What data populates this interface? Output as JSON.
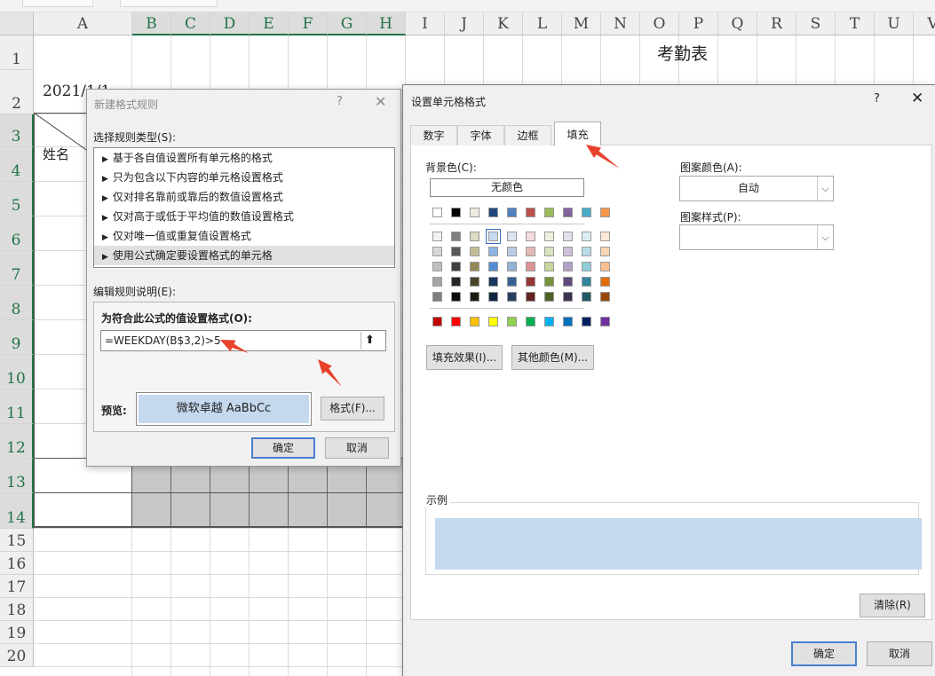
{
  "spreadsheet": {
    "columns": [
      "A",
      "B",
      "C",
      "D",
      "E",
      "F",
      "G",
      "H",
      "I",
      "J",
      "K",
      "L",
      "M",
      "N",
      "O",
      "P",
      "Q",
      "R",
      "S",
      "T",
      "U",
      "V"
    ],
    "rows": [
      "1",
      "2",
      "3",
      "4",
      "5",
      "6",
      "7",
      "8",
      "9",
      "10",
      "11",
      "12",
      "13",
      "14",
      "15",
      "16",
      "17",
      "18",
      "19",
      "20"
    ],
    "title": "考勤表",
    "date": "2021/1/1",
    "name_header": "姓名"
  },
  "rule_dialog": {
    "title": "新建格式规则",
    "help": "?",
    "close": "✕",
    "select_type_label": "选择规则类型(S):",
    "rule_types": [
      "基于各自值设置所有单元格的格式",
      "只为包含以下内容的单元格设置格式",
      "仅对排名靠前或靠后的数值设置格式",
      "仅对高于或低于平均值的数值设置格式",
      "仅对唯一值或重复值设置格式",
      "使用公式确定要设置格式的单元格"
    ],
    "selected_rule_index": 5,
    "edit_label": "编辑规则说明(E):",
    "formula_label": "为符合此公式的值设置格式(O):",
    "formula": "=WEEKDAY(B$3,2)>5",
    "collapse_icon": "⬆",
    "preview_label": "预览:",
    "preview_text": "微软卓越  AaBbCc",
    "preview_color": "#c4d8ee",
    "format_button": "格式(F)...",
    "ok_button": "确定",
    "cancel_button": "取消"
  },
  "format_dialog": {
    "title": "设置单元格格式",
    "help": "?",
    "close": "✕",
    "tabs": [
      "数字",
      "字体",
      "边框",
      "填充"
    ],
    "active_tab": "填充",
    "bg_color_label": "背景色(C):",
    "no_color_button": "无颜色",
    "theme_colors_top": [
      "#ffffff",
      "#000000",
      "#eeece1",
      "#1f497d",
      "#4f81bd",
      "#c0504d",
      "#9bbb59",
      "#8064a2",
      "#4bacc6",
      "#f79646"
    ],
    "theme_shades": [
      [
        "#f2f2f2",
        "#7f7f7f",
        "#ddd9c3",
        "#c6d9f0",
        "#dbe5f1",
        "#f2dcdb",
        "#ebf1dd",
        "#e5e0ec",
        "#dbeef3",
        "#fdeada"
      ],
      [
        "#d8d8d8",
        "#595959",
        "#c4bd97",
        "#8db3e2",
        "#b8cce4",
        "#e5b9b7",
        "#d7e3bc",
        "#ccc1d9",
        "#b7dde8",
        "#fbd5b5"
      ],
      [
        "#bfbfbf",
        "#3f3f3f",
        "#938953",
        "#548dd4",
        "#95b3d7",
        "#d99694",
        "#c3d69b",
        "#b2a2c7",
        "#92cddc",
        "#fac08f"
      ],
      [
        "#a5a5a5",
        "#262626",
        "#494429",
        "#17365d",
        "#366092",
        "#953734",
        "#76923c",
        "#5f497a",
        "#31859b",
        "#e36c09"
      ],
      [
        "#7f7f7f",
        "#0c0c0c",
        "#1d1b10",
        "#0f243e",
        "#244061",
        "#632423",
        "#4f6128",
        "#3f3151",
        "#205867",
        "#974806"
      ]
    ],
    "selected_swatch": "#c6d9f0",
    "standard_colors": [
      "#c00000",
      "#ff0000",
      "#ffc000",
      "#ffff00",
      "#92d050",
      "#00b050",
      "#00b0f0",
      "#0070c0",
      "#002060",
      "#7030a0"
    ],
    "fill_effects_button": "填充效果(I)...",
    "more_colors_button": "其他颜色(M)...",
    "pattern_color_label": "图案颜色(A):",
    "pattern_color_value": "自动",
    "pattern_style_label": "图案样式(P):",
    "pattern_style_value": "",
    "dropdown_icon": "⌵",
    "sample_label": "示例",
    "sample_color": "#c4d8ee",
    "clear_button": "清除(R)",
    "ok_button": "确定",
    "cancel_button": "取消"
  },
  "annotations": {
    "arrow_color": "#e8412c"
  }
}
